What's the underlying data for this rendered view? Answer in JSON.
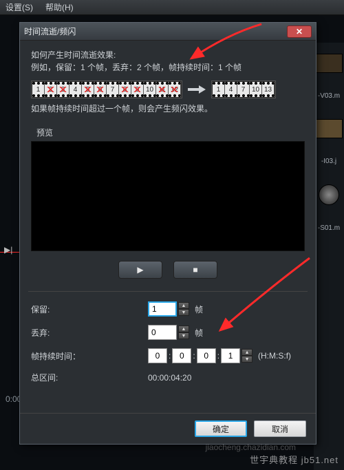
{
  "menu": {
    "settings": "设置(S)",
    "help": "帮助(H)"
  },
  "dialog": {
    "title": "时间流逝/频闪",
    "intro1": "如何产生时间流逝效果:",
    "intro2": "例如，保留：1 个帧，丢弃：2 个帧，帧持续时间：1 个帧",
    "film_in": [
      "1",
      "2",
      "3",
      "4",
      "5",
      "6",
      "7",
      "8",
      "9",
      "10",
      "11",
      "12"
    ],
    "film_in_x": [
      false,
      true,
      true,
      false,
      true,
      true,
      false,
      true,
      true,
      false,
      true,
      true
    ],
    "film_out": [
      "1",
      "4",
      "7",
      "10",
      "13"
    ],
    "note": "如果帧持续时间超过一个帧，则会产生频闪效果。",
    "preview_label": "预览",
    "keep_label": "保留:",
    "keep_value": "1",
    "keep_unit": "帧",
    "drop_label": "丢弃:",
    "drop_value": "0",
    "drop_unit": "帧",
    "dur_label": "帧持续时间：",
    "dur_h": "0",
    "dur_m": "0",
    "dur_s": "0",
    "dur_f": "1",
    "dur_fmt": "(H:M:S:f)",
    "total_label": "总区间:",
    "total_value": "00:00:04:20",
    "ok": "确定",
    "cancel": "取消"
  },
  "side": {
    "v03": "-V03.m",
    "i03": "-I03.j",
    "s01": "-S01.m"
  },
  "timeline": {
    "t0": "0:00"
  },
  "watermark": "世宇典教程 jb51.net",
  "watermark2": "jiaocheng.chazidian.com"
}
